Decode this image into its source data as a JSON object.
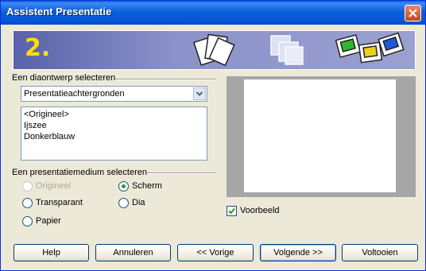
{
  "window": {
    "title": "Assistent Presentatie"
  },
  "banner": {
    "step": "2."
  },
  "design": {
    "section_label": "Een diaontwerp selecteren",
    "category_value": "Presentatieachtergronden",
    "items": [
      "<Origineel>",
      "Ijszee",
      "Donkerblauw"
    ]
  },
  "medium": {
    "section_label": "Een presentatiemedium selecteren",
    "options": [
      {
        "label": "Origineel",
        "selected": false,
        "enabled": false
      },
      {
        "label": "Scherm",
        "selected": true,
        "enabled": true
      },
      {
        "label": "Transparant",
        "selected": false,
        "enabled": true
      },
      {
        "label": "Dia",
        "selected": false,
        "enabled": true
      },
      {
        "label": "Papier",
        "selected": false,
        "enabled": true
      }
    ]
  },
  "preview": {
    "checkbox_label": "Voorbeeld",
    "checked": true
  },
  "buttons": {
    "help": "Help",
    "cancel": "Annuleren",
    "back": "<< Vorige",
    "next": "Volgende >>",
    "finish": "Voltooien"
  },
  "colors": {
    "title_bar": "#0a5fd8",
    "banner": "#5961a9",
    "step_number": "#ffe000",
    "radio_dot": "#21a121"
  }
}
